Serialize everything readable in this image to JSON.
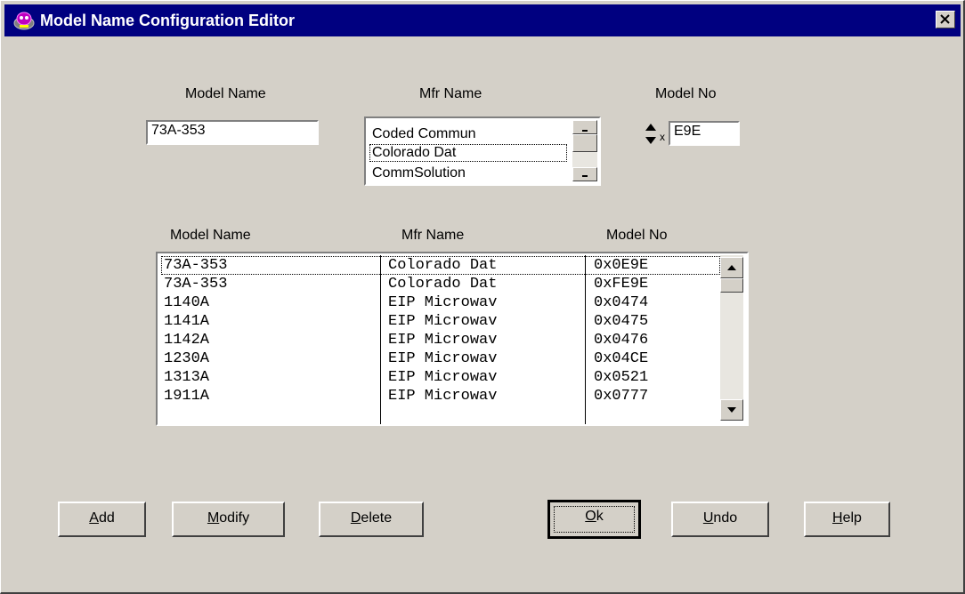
{
  "window": {
    "title": "Model Name Configuration Editor",
    "icon": "app-icon",
    "close_icon": "close-icon"
  },
  "form": {
    "model_name_label": "Model Name",
    "model_name_value": "73A-353",
    "mfr_name_label": "Mfr Name",
    "mfr_list_items": [
      "Coded Commun",
      "Colorado Dat",
      "CommSolution"
    ],
    "mfr_selected_index": 1,
    "model_no_label": "Model No",
    "model_no_prefix": "x",
    "model_no_value": "E9E"
  },
  "grid": {
    "headers": [
      "Model Name",
      "Mfr Name",
      "Model No"
    ],
    "rows": [
      [
        "73A-353",
        "Colorado Dat",
        "0x0E9E"
      ],
      [
        "73A-353",
        "Colorado Dat",
        "0xFE9E"
      ],
      [
        "1140A",
        "EIP Microwav",
        "0x0474"
      ],
      [
        "1141A",
        "EIP Microwav",
        "0x0475"
      ],
      [
        "1142A",
        "EIP Microwav",
        "0x0476"
      ],
      [
        "1230A",
        "EIP Microwav",
        "0x04CE"
      ],
      [
        "1313A",
        "EIP Microwav",
        "0x0521"
      ],
      [
        "1911A",
        "EIP Microwav",
        "0x0777"
      ]
    ]
  },
  "buttons": {
    "add": {
      "mnemonic": "A",
      "rest": "dd"
    },
    "modify": {
      "mnemonic": "M",
      "rest": "odify"
    },
    "delete": {
      "mnemonic": "D",
      "rest": "elete"
    },
    "ok": {
      "mnemonic": "O",
      "rest": "k"
    },
    "undo": {
      "mnemonic": "U",
      "rest": "ndo"
    },
    "help": {
      "mnemonic": "H",
      "rest": "elp"
    }
  },
  "colors": {
    "titlebar": "#000080",
    "face": "#d4d0c8"
  }
}
